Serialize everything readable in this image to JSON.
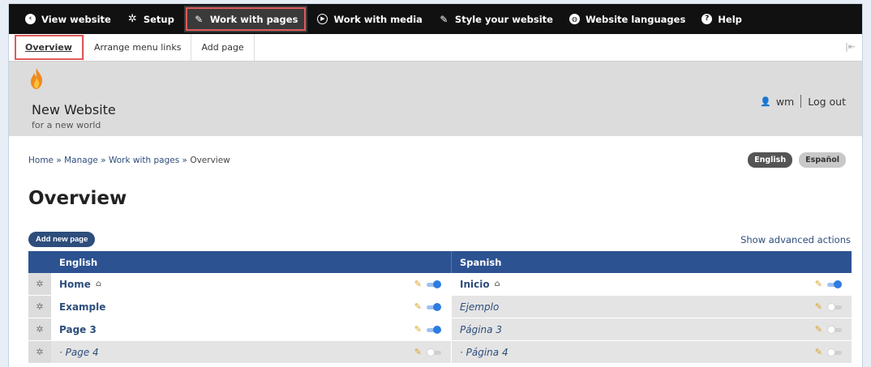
{
  "toolbar": {
    "items": [
      {
        "label": "View website",
        "icon": "chevron-left-circle-icon"
      },
      {
        "label": "Setup",
        "icon": "gear-icon"
      },
      {
        "label": "Work with pages",
        "icon": "pencil-icon",
        "active": true
      },
      {
        "label": "Work with media",
        "icon": "play-circle-icon"
      },
      {
        "label": "Style your website",
        "icon": "brush-icon"
      },
      {
        "label": "Website languages",
        "icon": "globe-icon"
      },
      {
        "label": "Help",
        "icon": "question-circle-icon"
      }
    ]
  },
  "tabs": {
    "items": [
      {
        "label": "Overview",
        "active": true
      },
      {
        "label": "Arrange menu links"
      },
      {
        "label": "Add page"
      }
    ]
  },
  "site": {
    "name": "New Website",
    "slogan": "for a new world",
    "user": "wm",
    "logout": "Log out"
  },
  "breadcrumb": {
    "home": "Home",
    "sep": " » ",
    "manage": "Manage",
    "section": "Work with pages",
    "current": "Overview"
  },
  "languages": [
    "English",
    "Español"
  ],
  "page": {
    "title": "Overview",
    "add_button": "Add new page",
    "advanced_link": "Show advanced actions"
  },
  "table": {
    "headers": [
      "English",
      "Spanish"
    ],
    "rows": [
      {
        "en": "Home",
        "es": "Inicio",
        "home": true,
        "en_pub": true,
        "es_pub": true
      },
      {
        "en": "Example",
        "es": "Ejemplo",
        "en_pub": true,
        "es_pub": false
      },
      {
        "en": "Page 3",
        "es": "Página 3",
        "en_pub": true,
        "es_pub": false
      },
      {
        "en": "· Page 4",
        "es": "· Página 4",
        "en_pub": false,
        "es_pub": false
      }
    ]
  },
  "colors": {
    "toolbar_bg": "#111111",
    "accent_blue": "#2c5291",
    "highlight_red": "#e05a5a",
    "toggle_on": "#2f7ce0",
    "pencil": "#d9a32a"
  }
}
